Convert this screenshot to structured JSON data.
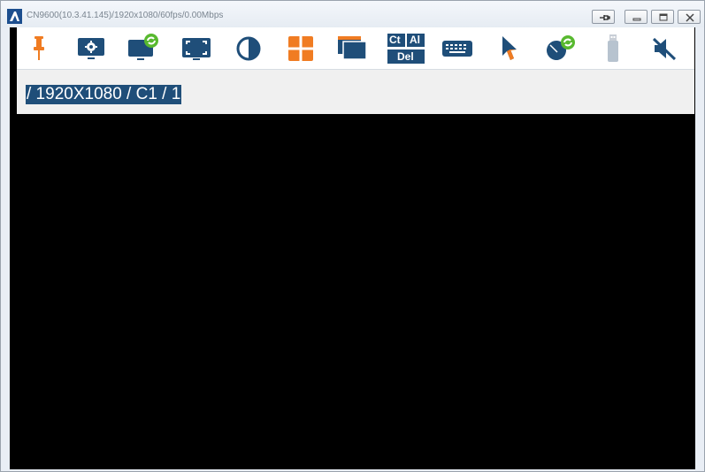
{
  "window": {
    "title": "CN9600(10.3.41.145)/1920x1080/60fps/0.00Mbps"
  },
  "toolbar": {
    "items": [
      {
        "name": "pin",
        "icon": "pushpin-icon"
      },
      {
        "name": "settings",
        "icon": "monitor-gear-icon"
      },
      {
        "name": "video-refresh",
        "icon": "monitor-refresh-icon"
      },
      {
        "name": "full-screen",
        "icon": "fullscreen-icon"
      },
      {
        "name": "contrast",
        "icon": "contrast-icon"
      },
      {
        "name": "panel-array",
        "icon": "grid-icon"
      },
      {
        "name": "window",
        "icon": "window-icon"
      },
      {
        "name": "ctrl-alt-del",
        "icon": "ctrl-alt-del-icon",
        "label_top_left": "Ct",
        "label_top_right": "Al",
        "label_bottom": "Del"
      },
      {
        "name": "keyboard",
        "icon": "keyboard-icon"
      },
      {
        "name": "mouse-pointer",
        "icon": "cursor-icon"
      },
      {
        "name": "mouse-sync",
        "icon": "mouse-refresh-icon"
      },
      {
        "name": "usb",
        "icon": "usb-icon"
      },
      {
        "name": "audio",
        "icon": "speaker-mute-icon"
      }
    ]
  },
  "info": {
    "text": "/ 1920X1080 / C1 / 1"
  },
  "colors": {
    "accent": "#1f4e79",
    "orange": "#f07c22",
    "green": "#58b92f",
    "icon_blue": "#1f4e79"
  }
}
